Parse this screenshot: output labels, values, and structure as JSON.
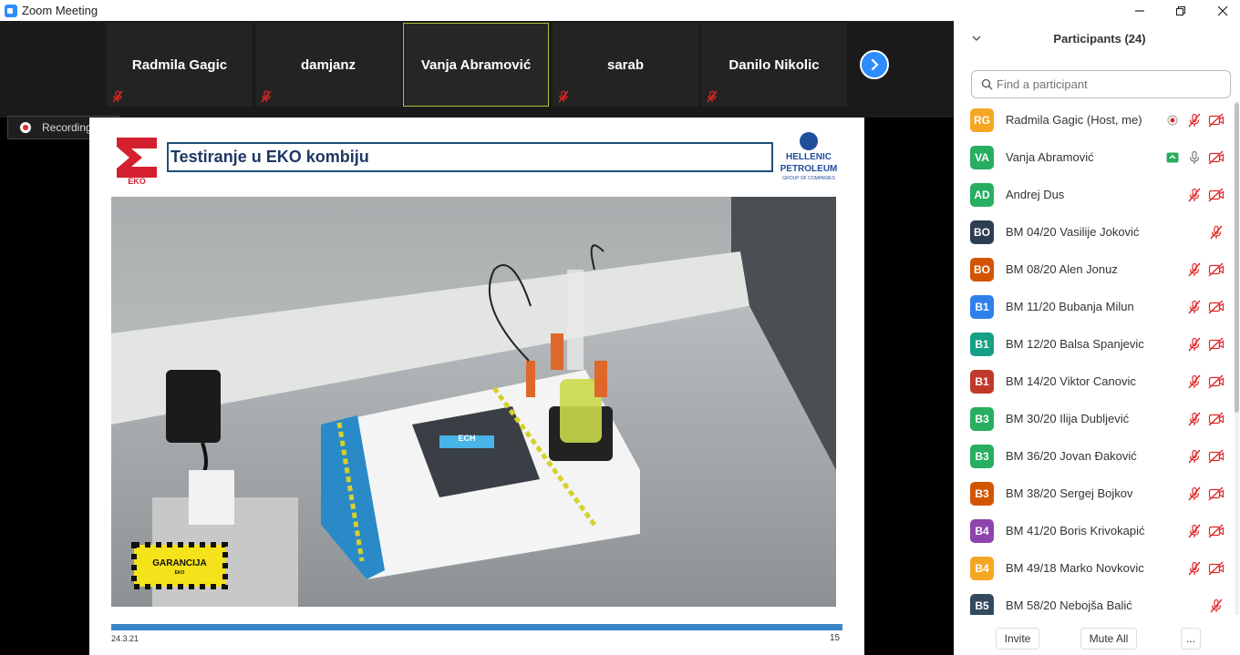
{
  "window": {
    "title": "Zoom Meeting",
    "icons": {
      "app": "zoom-camera-icon",
      "minimize": "minimize-icon",
      "maximize": "restore-icon",
      "close": "close-icon"
    }
  },
  "gallery": {
    "tiles": [
      {
        "name": "Radmila Gagic",
        "muted": true,
        "active": false
      },
      {
        "name": "damjanz",
        "muted": true,
        "active": false
      },
      {
        "name": "Vanja Abramović",
        "muted": false,
        "active": true
      },
      {
        "name": "sarab",
        "muted": true,
        "active": false
      },
      {
        "name": "Danilo Nikolic",
        "muted": true,
        "active": false
      }
    ],
    "next_icon": "chevron-right-icon"
  },
  "recording": {
    "label": "Recording..."
  },
  "slide": {
    "title": "Testiranje u EKO kombiju",
    "eko_logo_text": "EKO",
    "hp_logo_line1": "HELLENIC",
    "hp_logo_line2": "PETROLEUM",
    "hp_logo_line3": "GROUP OF COMPANIES",
    "badge_line1": "GARANCIJA",
    "badge_line2": "EKO",
    "device_label": "ECH",
    "date": "24.3.21",
    "page": "15"
  },
  "participants": {
    "header": "Participants (24)",
    "search_placeholder": "Find a participant",
    "colors": {
      "orange": "#F5A623",
      "green": "#27AE60",
      "navy": "#2C3E50",
      "darkorange": "#D35400",
      "blue": "#2F80ED",
      "teal": "#16A085",
      "red": "#C0392B",
      "purple": "#8E44AD",
      "darknavy": "#34495E"
    },
    "list": [
      {
        "initials": "RG",
        "name": "Radmila Gagic (Host, me)",
        "color": "#F5A623",
        "mic": "muted",
        "video": "off",
        "extra": "recording"
      },
      {
        "initials": "VA",
        "name": "Vanja Abramović",
        "color": "#27AE60",
        "mic": "on",
        "video": "off",
        "extra": "share"
      },
      {
        "initials": "AD",
        "name": "Andrej Dus",
        "color": "#27AE60",
        "mic": "muted",
        "video": "off",
        "extra": ""
      },
      {
        "initials": "BO",
        "name": "BM 04/20 Vasilije Joković",
        "color": "#2C3E50",
        "mic": "muted",
        "video": "none",
        "extra": ""
      },
      {
        "initials": "BO",
        "name": "BM 08/20 Alen Jonuz",
        "color": "#D35400",
        "mic": "muted",
        "video": "off",
        "extra": ""
      },
      {
        "initials": "B1",
        "name": "BM 11/20 Bubanja Milun",
        "color": "#2F80ED",
        "mic": "muted",
        "video": "off",
        "extra": ""
      },
      {
        "initials": "B1",
        "name": "BM 12/20 Balsa Spanjevic",
        "color": "#16A085",
        "mic": "muted",
        "video": "off",
        "extra": ""
      },
      {
        "initials": "B1",
        "name": "BM 14/20 Viktor Canovic",
        "color": "#C0392B",
        "mic": "muted",
        "video": "off",
        "extra": ""
      },
      {
        "initials": "B3",
        "name": "BM 30/20 Ilija Dubljević",
        "color": "#27AE60",
        "mic": "muted",
        "video": "off",
        "extra": ""
      },
      {
        "initials": "B3",
        "name": "BM 36/20 Jovan Đaković",
        "color": "#27AE60",
        "mic": "muted",
        "video": "off",
        "extra": ""
      },
      {
        "initials": "B3",
        "name": "BM 38/20 Sergej Bojkov",
        "color": "#D35400",
        "mic": "muted",
        "video": "off",
        "extra": ""
      },
      {
        "initials": "B4",
        "name": "BM 41/20 Boris Krivokapić",
        "color": "#8E44AD",
        "mic": "muted",
        "video": "off",
        "extra": ""
      },
      {
        "initials": "B4",
        "name": "BM 49/18 Marko Novkovic",
        "color": "#F5A623",
        "mic": "muted",
        "video": "off",
        "extra": ""
      },
      {
        "initials": "B5",
        "name": "BM 58/20 Nebojša Balić",
        "color": "#34495E",
        "mic": "muted",
        "video": "none",
        "extra": ""
      }
    ]
  },
  "footer": {
    "invite": "Invite",
    "mute_all": "Mute All",
    "more": "..."
  }
}
